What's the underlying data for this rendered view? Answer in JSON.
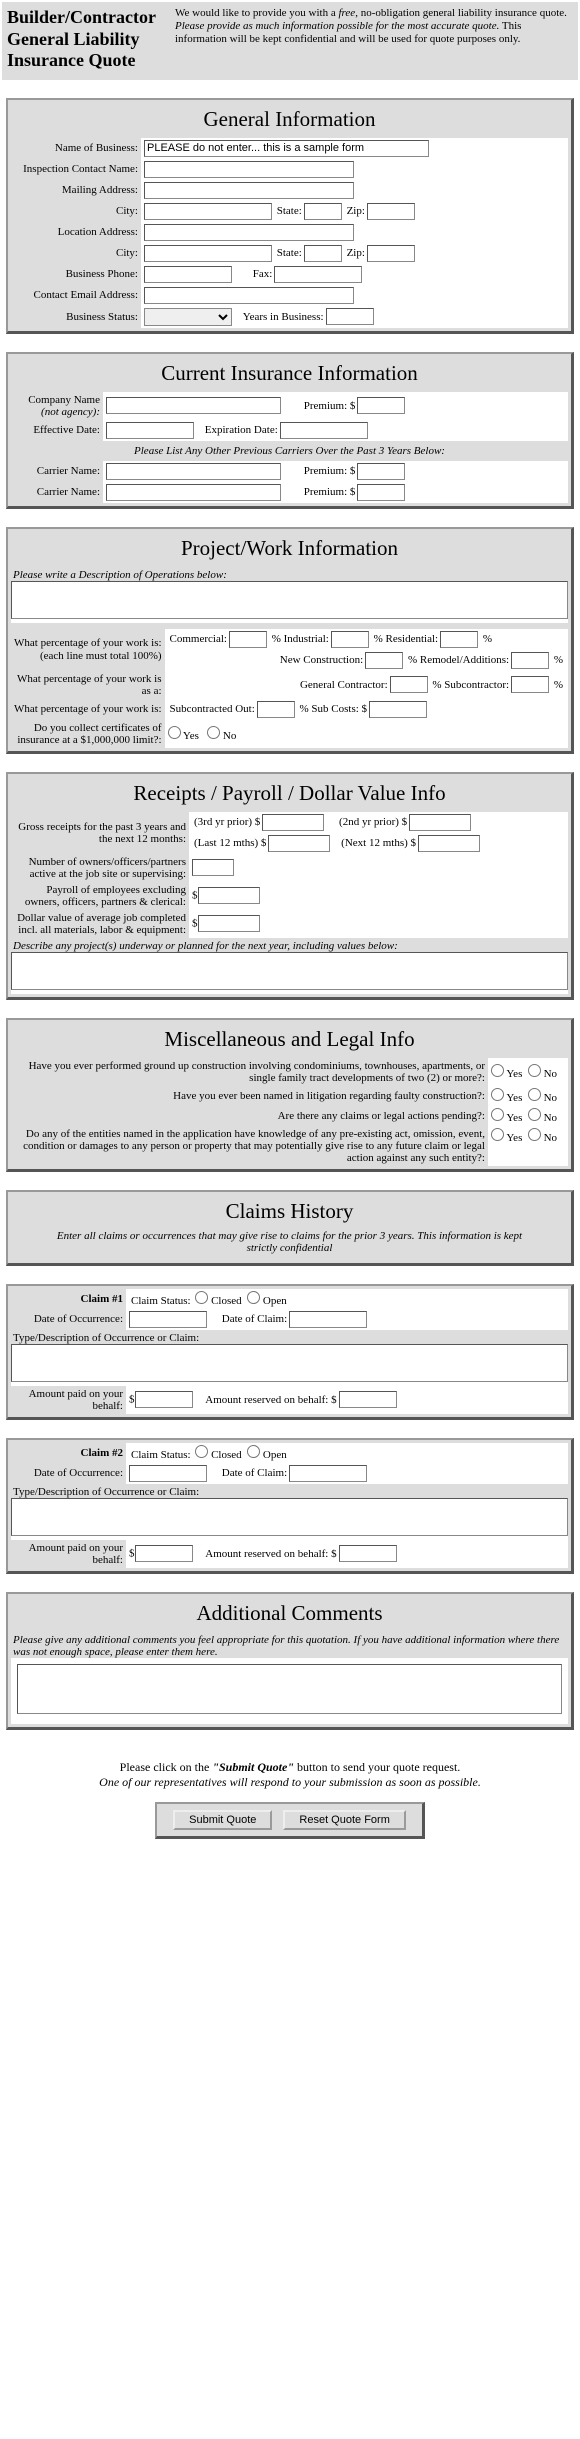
{
  "header": {
    "title": "Builder/Contractor General Liability Insurance Quote",
    "intro_pre": "We would like to provide you with a ",
    "intro_em1": "free",
    "intro_mid1": ", no-obligation general liability insurance quote. ",
    "intro_em2": "Please provide as much information possible for the most accurate quote.",
    "intro_post": " This information will be kept confidential and will be used for quote purposes only."
  },
  "general": {
    "title": "General Information",
    "name_lbl": "Name of Business:",
    "name_val": "PLEASE do not enter... this is a sample form",
    "contact_lbl": "Inspection Contact Name:",
    "mailing_lbl": "Mailing Address:",
    "city_lbl": "City:",
    "state_lbl": "State:",
    "zip_lbl": "Zip:",
    "location_lbl": "Location Address:",
    "phone_lbl": "Business Phone:",
    "fax_lbl": "Fax:",
    "email_lbl": "Contact Email Address:",
    "status_lbl": "Business Status:",
    "years_lbl": "Years in Business:"
  },
  "current": {
    "title": "Current Insurance Information",
    "company_lbl1": "Company Name",
    "company_lbl2": "(not agency):",
    "premium_lbl": "Premium: $",
    "effective_lbl": "Effective Date:",
    "expiration_lbl": "Expiration Date:",
    "prev_hdr": "Please List Any Other Previous Carriers Over the Past 3 Years Below:",
    "carrier_lbl": "Carrier Name:"
  },
  "project": {
    "title": "Project/Work Information",
    "desc_lbl": "Please write a Description of Operations below:",
    "pct_lbl1": "What percentage of your work is:",
    "pct_lbl2": "(each line must total 100%)",
    "commercial": "Commercial:",
    "industrial": "%  Industrial:",
    "residential": "%  Residential:",
    "pct_suffix": "%",
    "newconst": "New Construction:",
    "remodel": "%  Remodel/Additions:",
    "asa_lbl": "What percentage of your work is as a:",
    "gencon": "General Contractor:",
    "subcon": "%  Subcontractor:",
    "pct3_lbl": "What percentage of your work is:",
    "subout": "Subcontracted Out:",
    "subcosts": "%   Sub Costs: $",
    "cert_lbl": "Do you collect certificates of insurance at a $1,000,000 limit?:",
    "yes": "Yes",
    "no": "No"
  },
  "receipts": {
    "title": "Receipts / Payroll / Dollar Value Info",
    "gross_lbl": "Gross receipts for the past 3 years and the next 12 months:",
    "y3": "(3rd yr prior) $",
    "y2": "(2nd yr prior) $",
    "l12": "(Last 12 mths) $",
    "n12": "(Next 12 mths) $",
    "owners_lbl": "Number of owners/officers/partners active at the job site or supervising:",
    "payroll_lbl": "Payroll of employees excluding owners, officers, partners & clerical:",
    "dollar_val": "$",
    "avgjob_lbl": "Dollar value of average job completed incl. all materials, labor & equipment:",
    "desc_proj": "Describe any project(s) underway or planned for the next year, including values below:"
  },
  "misc": {
    "title": "Miscellaneous and Legal Info",
    "q1": "Have you ever performed ground up construction involving condominiums, townhouses, apartments, or single family tract developments of two (2) or more?:",
    "q2": "Have you ever been named in litigation regarding faulty construction?:",
    "q3": "Are there any claims or legal actions pending?:",
    "q4": "Do any of the entities named in the application have knowledge of any pre-existing act, omission, event, condition or damages to any person or property that may potentially give rise to any future claim or legal action against any such entity?:",
    "yes": "Yes",
    "no": "No"
  },
  "claims": {
    "title": "Claims History",
    "sub": "Enter all claims or occurrences that may give rise to claims for the prior 3 years. This information is kept strictly confidential",
    "c1": "Claim #1",
    "c2": "Claim #2",
    "status_lbl": "Claim Status:",
    "closed": "Closed",
    "open": "Open",
    "date_occ": "Date of Occurrence:",
    "date_claim": "Date of Claim:",
    "type_lbl": "Type/Description of Occurrence or Claim:",
    "paid_lbl": "Amount paid on your behalf:",
    "reserved_lbl": "Amount reserved on behalf: $",
    "dollar": "$"
  },
  "additional": {
    "title": "Additional Comments",
    "sub": "Please give any additional comments you feel appropriate for this quotation. If you have additional information where there was not enough space, please enter them here."
  },
  "footer": {
    "msg1": "Please click on the ",
    "msg1b": "\"Submit Quote\"",
    "msg1c": " button to send your quote request.",
    "msg2": "One of our representatives will respond to your submission as soon as possible.",
    "submit": "Submit Quote",
    "reset": "Reset Quote Form"
  }
}
